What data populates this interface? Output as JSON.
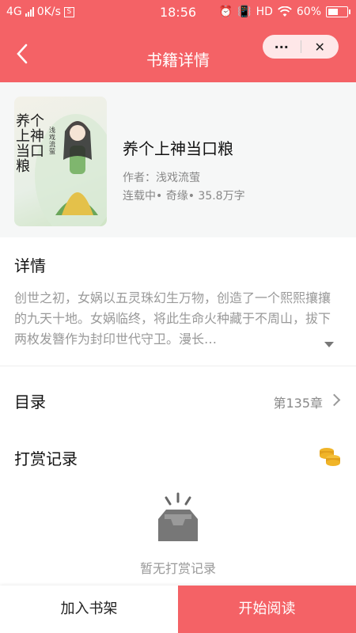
{
  "status_bar": {
    "network": "4G",
    "speed": "0K/s",
    "sim_icon": "S",
    "time": "18:56",
    "hd": "HD",
    "battery": "60%",
    "battery_level": 0.6
  },
  "nav": {
    "title": "书籍详情",
    "back_icon": "chevron-left-icon",
    "more_label": "···",
    "close_label": "✕"
  },
  "book": {
    "title": "养个上神当口粮",
    "author_line": "作者：浅戏流萤",
    "meta_line": "连载中• 奇缘• 35.8万字",
    "cover": {
      "title_text": "养个上神当口粮",
      "author_text": "浅戏流萤"
    }
  },
  "detail": {
    "heading": "详情",
    "text": "创世之初，女娲以五灵珠幻生万物，创造了一个熙熙攘攘的九天十地。女娲临终，将此生命火种藏于不周山，拔下两枚发簪作为封印世代守卫。漫长…"
  },
  "toc": {
    "label": "目录",
    "chapter": "第135章"
  },
  "reward": {
    "label": "打赏记录",
    "empty_text": "暂无打赏记录"
  },
  "actions": {
    "add_shelf": "加入书架",
    "start_reading": "开始阅读"
  },
  "colors": {
    "accent": "#f46266"
  }
}
